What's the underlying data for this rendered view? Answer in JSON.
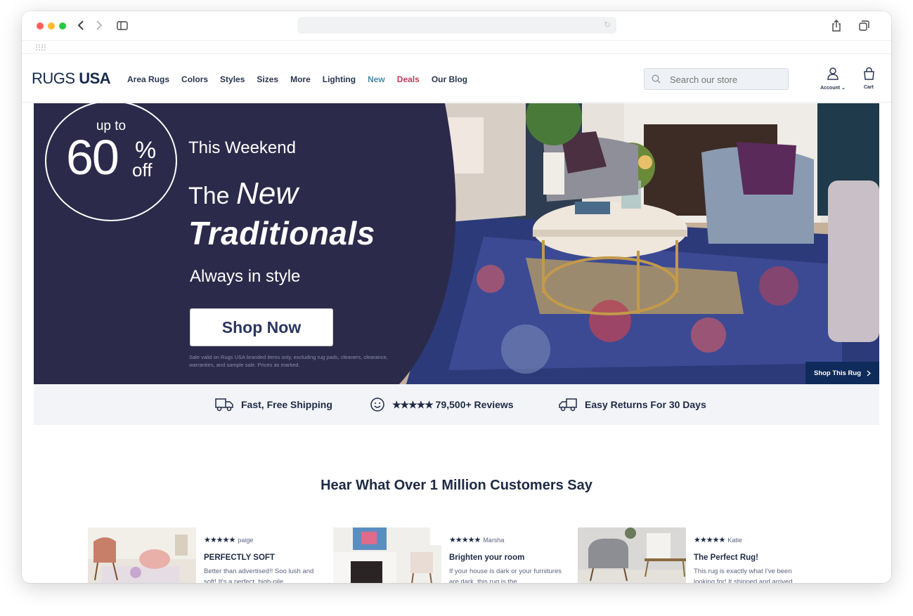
{
  "browser": {
    "url": "",
    "traffic_lights": [
      "#ff5f57",
      "#febc2e",
      "#28c840"
    ]
  },
  "header": {
    "logo_light": "RUGS",
    "logo_bold": "USA",
    "nav": [
      {
        "label": "Area Rugs",
        "color": "#2a3650"
      },
      {
        "label": "Colors",
        "color": "#2a3650"
      },
      {
        "label": "Styles",
        "color": "#2a3650"
      },
      {
        "label": "Sizes",
        "color": "#2a3650"
      },
      {
        "label": "More",
        "color": "#2a3650"
      },
      {
        "label": "Lighting",
        "color": "#2a3650"
      },
      {
        "label": "New",
        "color": "#4a8fa8"
      },
      {
        "label": "Deals",
        "color": "#c23a5a"
      },
      {
        "label": "Our Blog",
        "color": "#2a3650"
      }
    ],
    "search_placeholder": "Search our store",
    "account_label": "Account",
    "cart_label": "Cart"
  },
  "hero": {
    "badge_upto": "up to",
    "badge_pct": "60",
    "badge_pctsign": "%",
    "badge_off": "off",
    "weekend": "This Weekend",
    "the": "The",
    "new": "New",
    "traditionals": "Traditionals",
    "tagline": "Always in style",
    "cta": "Shop Now",
    "fineprint": "Sale valid on Rugs USA branded items only, excluding rug pads, cleaners, clearance, warranties, and sample sale. Prices as marked.",
    "shop_rug": "Shop This Rug",
    "panel_color": "#2c2a4a"
  },
  "trust": {
    "shipping": "Fast, Free Shipping",
    "stars": "★★★★★",
    "reviews": "79,500+ Reviews",
    "returns": "Easy Returns For 30 Days"
  },
  "reviews_section": {
    "title": "Hear What Over 1 Million Customers Say",
    "items": [
      {
        "stars": "★★★★★",
        "name": "paige",
        "title": "PERFECTLY SOFT",
        "text": "Better than advertised!! Soo lush and soft! It's a perfect, high-pile"
      },
      {
        "stars": "★★★★★",
        "name": "Marsha",
        "title": "Brighten your room",
        "text": "If your house is dark or your furnitures are dark, this rug is the"
      },
      {
        "stars": "★★★★★",
        "name": "Katie",
        "title": "The Perfect Rug!",
        "text": "This rug is exactly what I've been looking for! It shipped and arrived"
      }
    ]
  }
}
